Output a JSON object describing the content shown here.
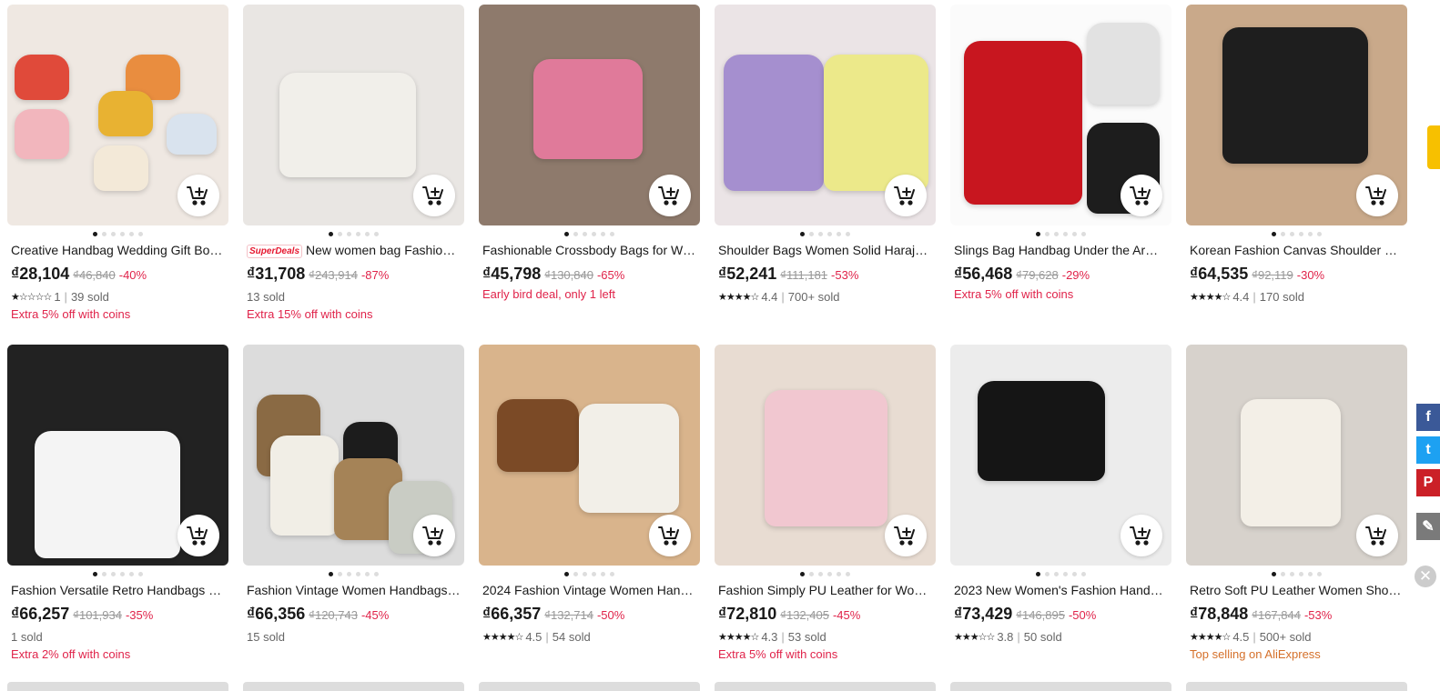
{
  "products": [
    {
      "title": "Creative Handbag Wedding Gift Box...",
      "superdeals": "",
      "price": "₫28,104",
      "original": "₫46,840",
      "discount": "-40%",
      "stars": "★☆☆☆☆",
      "rating": "1",
      "sold": "39 sold",
      "promo": "Extra 5% off with coins",
      "bg": "#efe8e2",
      "bags": [
        "#e04a3a",
        "#e98d3f",
        "#f2b6bd",
        "#e8b232",
        "#d9e3ee",
        "#f3e9d8"
      ]
    },
    {
      "title": "New women bag Fashion ...",
      "superdeals": "SuperDeals",
      "price": "₫31,708",
      "original": "₫243,914",
      "discount": "-87%",
      "stars": "",
      "rating": "",
      "sold": "13 sold",
      "promo": "Extra 15% off with coins",
      "bg": "#e9e6e3",
      "bags": [
        "#f1efea"
      ]
    },
    {
      "title": "Fashionable Crossbody Bags for Wo...",
      "superdeals": "",
      "price": "₫45,798",
      "original": "₫130,840",
      "discount": "-65%",
      "stars": "",
      "rating": "",
      "sold": "",
      "promo": "Early bird deal, only 1 left",
      "bg": "#8e7a6c",
      "bags": [
        "#e07a9a"
      ]
    },
    {
      "title": "Shoulder Bags Women Solid Haraju...",
      "superdeals": "",
      "price": "₫52,241",
      "original": "₫111,181",
      "discount": "-53%",
      "stars": "★★★★☆",
      "rating": "4.4",
      "sold": "700+ sold",
      "promo": "",
      "bg": "#ebe4e6",
      "bags": [
        "#a58fcf",
        "#ece98a"
      ]
    },
    {
      "title": "Slings Bag Handbag Under the Arm ...",
      "superdeals": "",
      "price": "₫56,468",
      "original": "₫79,628",
      "discount": "-29%",
      "stars": "",
      "rating": "",
      "sold": "",
      "promo": "Extra 5% off with coins",
      "bg": "#fbfbfb",
      "bags": [
        "#c8161f",
        "#e2e2e2",
        "#1d1d1d"
      ]
    },
    {
      "title": "Korean Fashion Canvas Shoulder W...",
      "superdeals": "",
      "price": "₫64,535",
      "original": "₫92,119",
      "discount": "-30%",
      "stars": "★★★★☆",
      "rating": "4.4",
      "sold": "170 sold",
      "promo": "",
      "bg": "#c9a98a",
      "bags": [
        "#1e1e1e"
      ]
    },
    {
      "title": "Fashion Versatile Retro Handbags fo...",
      "superdeals": "",
      "price": "₫66,257",
      "original": "₫101,934",
      "discount": "-35%",
      "stars": "",
      "rating": "",
      "sold": "1 sold",
      "promo": "Extra 2% off with coins",
      "bg": "#222",
      "bags": [
        "#f4f4f4"
      ]
    },
    {
      "title": "Fashion Vintage Women Handbags ...",
      "superdeals": "",
      "price": "₫66,356",
      "original": "₫120,743",
      "discount": "-45%",
      "stars": "",
      "rating": "",
      "sold": "15 sold",
      "promo": "",
      "bg": "#dcdcdc",
      "bags": [
        "#8a6a44",
        "#f1eee6",
        "#1c1c1c",
        "#a58357",
        "#c9ccc4"
      ]
    },
    {
      "title": "2024 Fashion Vintage Women Hand...",
      "superdeals": "",
      "price": "₫66,357",
      "original": "₫132,714",
      "discount": "-50%",
      "stars": "★★★★☆",
      "rating": "4.5",
      "sold": "54 sold",
      "promo": "",
      "bg": "#d9b48c",
      "bags": [
        "#7b4a26",
        "#f2efe8"
      ]
    },
    {
      "title": "Fashion Simply PU Leather for Wom...",
      "superdeals": "",
      "price": "₫72,810",
      "original": "₫132,405",
      "discount": "-45%",
      "stars": "★★★★☆",
      "rating": "4.3",
      "sold": "53 sold",
      "promo": "Extra 5% off with coins",
      "bg": "#e8dcd2",
      "bags": [
        "#f1c7d0",
        "#ffffff"
      ]
    },
    {
      "title": "2023 New Women's Fashion Handb...",
      "superdeals": "",
      "price": "₫73,429",
      "original": "₫146,895",
      "discount": "-50%",
      "stars": "★★★☆☆",
      "rating": "3.8",
      "sold": "50 sold",
      "promo": "",
      "bg": "#ececec",
      "bags": [
        "#151515"
      ]
    },
    {
      "title": "Retro Soft PU Leather Women Shou...",
      "superdeals": "",
      "price": "₫78,848",
      "original": "₫167,844",
      "discount": "-53%",
      "stars": "★★★★☆",
      "rating": "4.5",
      "sold": "500+ sold",
      "promo": "Top selling on AliExpress",
      "bg": "#d7d2cc",
      "bags": [
        "#f3efe7"
      ]
    }
  ],
  "icons": {
    "cart": "add-to-cart-icon",
    "facebook": "facebook-icon",
    "twitter": "twitter-icon",
    "pinterest": "pinterest-icon",
    "edit": "edit-icon",
    "close": "close-icon"
  },
  "social": {
    "facebook": "f",
    "twitter": "t",
    "pinterest": "P",
    "edit": "✎",
    "close": "✕"
  },
  "colors": {
    "discount": "#e0234a",
    "facebook": "#3b5998",
    "twitter": "#1da1f2",
    "pinterest": "#cb2027",
    "edit": "#7a7a7a"
  }
}
